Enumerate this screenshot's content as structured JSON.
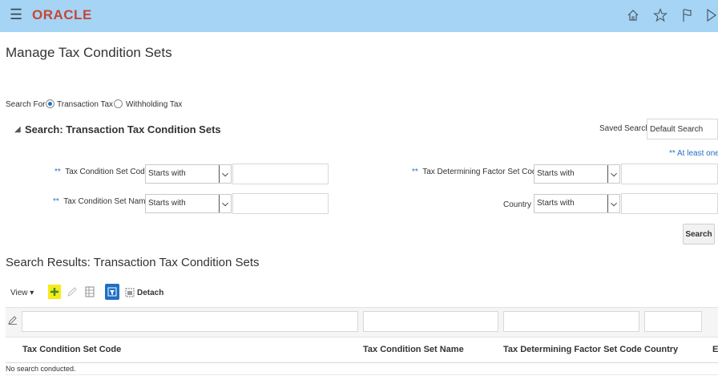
{
  "header": {
    "logo": "ORACLE",
    "icons": [
      "menu-icon",
      "home-icon",
      "star-icon",
      "flag-icon",
      "notification-icon"
    ]
  },
  "page": {
    "title": "Manage Tax Condition Sets"
  },
  "search_for": {
    "label": "Search For",
    "options": [
      "Transaction Tax",
      "Withholding Tax"
    ],
    "selected": "Transaction Tax"
  },
  "search": {
    "title": "Search: Transaction Tax Condition Sets",
    "saved_search_label": "Saved Search",
    "saved_search_value": "Default Search",
    "hint": "** At least one is",
    "required_marker": "**",
    "fields": {
      "code_label": "Tax Condition Set Code",
      "code_operator": "Starts with",
      "name_label": "Tax Condition Set Name",
      "name_operator": "Starts with",
      "factor_label": "Tax Determining Factor Set Code",
      "factor_operator": "Starts with",
      "country_label": "Country",
      "country_operator": "Starts with"
    },
    "button": "Search"
  },
  "results": {
    "title": "Search Results: Transaction Tax Condition Sets",
    "toolbar": {
      "view": "View ▾",
      "detach": "Detach"
    },
    "columns": [
      "Tax Condition Set Code",
      "Tax Condition Set Name",
      "Tax Determining Factor Set Code",
      "Country",
      "E"
    ],
    "empty": "No search conducted."
  },
  "colors": {
    "header_bg": "#a6d4f5",
    "logo": "#c74634",
    "accent": "#1f6fc5",
    "add_highlight": "#f6ea1c"
  }
}
